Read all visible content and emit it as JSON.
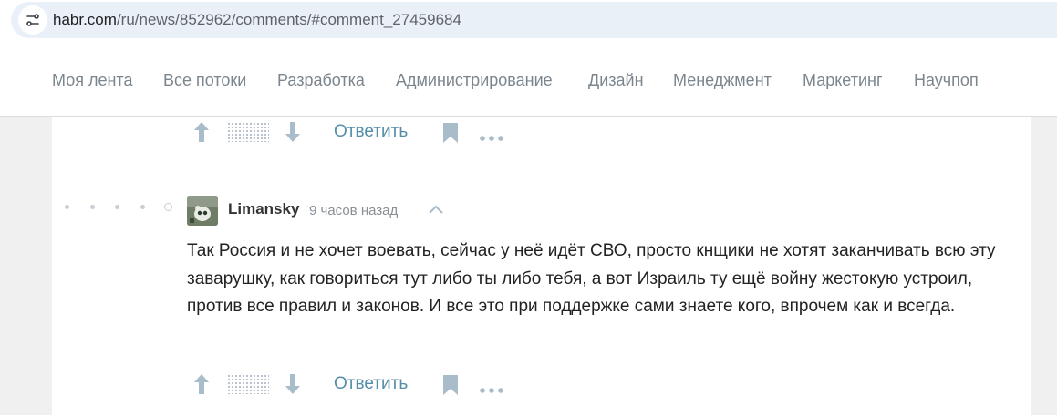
{
  "browser": {
    "url_host": "habr.com",
    "url_path": "/ru/news/852962/comments/#comment_27459684"
  },
  "nav": {
    "items": [
      "Моя лента",
      "Все потоки",
      "Разработка",
      "Администрирование",
      "Дизайн",
      "Менеджмент",
      "Маркетинг",
      "Научпоп"
    ]
  },
  "comments": [
    {
      "reply_label": "Ответить"
    },
    {
      "author": "Limansky",
      "time": "9 часов назад",
      "text": "Так Россия и не хочет воевать, сейчас у неё идёт СВО, просто кнщики не хотят заканчивать всю эту заварушку, как говориться тут либо ты либо тебя, а вот Израиль ту ещё войну жестокую устроил, против все правил и законов. И все это при поддержке сами знаете кого, впрочем как и всегда.",
      "reply_label": "Ответить"
    }
  ],
  "colors": {
    "accent": "#548eaa",
    "icon": "#a9bcc9",
    "nav_text": "#7b858d"
  },
  "icons": [
    "site-info-icon",
    "arrow-up-icon",
    "arrow-down-icon",
    "bookmark-icon",
    "more-icon",
    "chevron-up-icon",
    "avatar"
  ]
}
